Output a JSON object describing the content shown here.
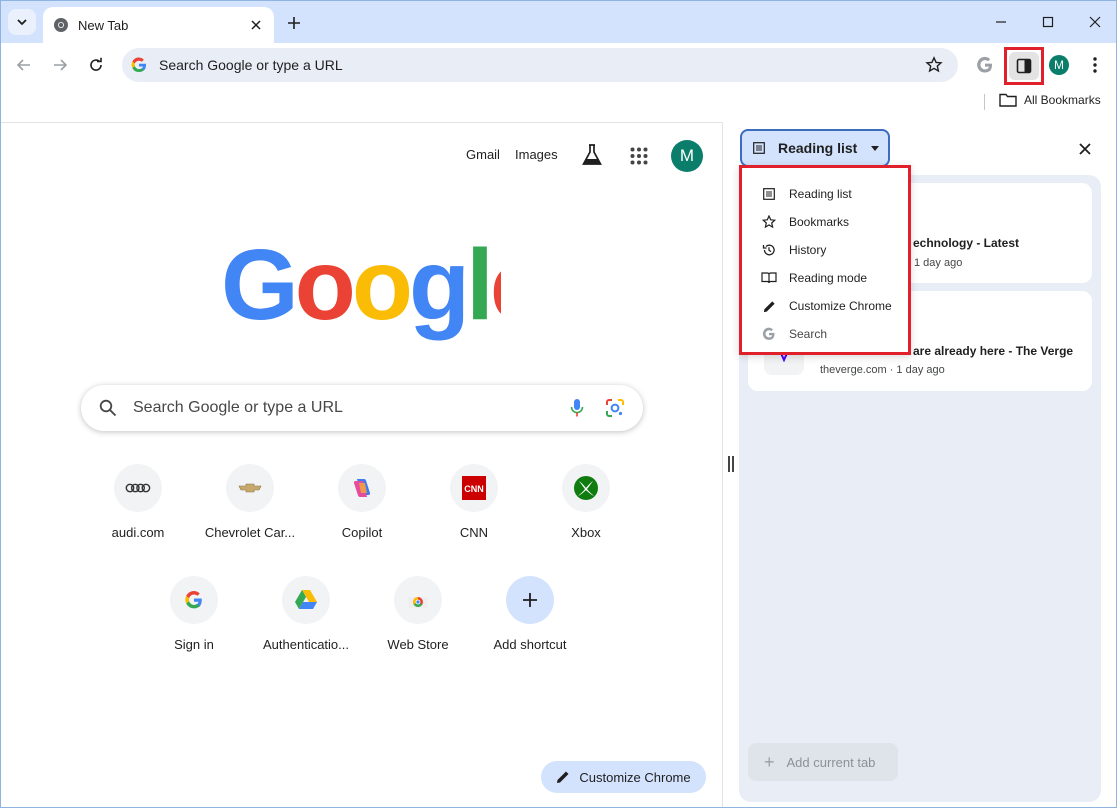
{
  "browser": {
    "tab": {
      "title": "New Tab"
    },
    "toolbar": {
      "omnibox_text": "Search Google or type a URL",
      "avatar_initial": "M"
    },
    "bookmarks_bar": {
      "all_bookmarks": "All Bookmarks"
    }
  },
  "ntp": {
    "links": {
      "gmail": "Gmail",
      "images": "Images"
    },
    "avatar_initial": "M",
    "search_placeholder": "Search Google or type a URL",
    "shortcuts": [
      {
        "label": "audi.com",
        "icon": "audi-logo-icon"
      },
      {
        "label": "Chevrolet Car...",
        "icon": "chevrolet-logo-icon"
      },
      {
        "label": "Copilot",
        "icon": "copilot-logo-icon"
      },
      {
        "label": "CNN",
        "icon": "cnn-logo-icon"
      },
      {
        "label": "Xbox",
        "icon": "xbox-logo-icon"
      },
      {
        "label": "Sign in",
        "icon": "google-g-icon"
      },
      {
        "label": "Authenticatio...",
        "icon": "google-drive-icon"
      },
      {
        "label": "Web Store",
        "icon": "chrome-web-store-icon"
      },
      {
        "label": "Add shortcut",
        "icon": "plus-icon"
      }
    ],
    "customize_button": "Customize Chrome"
  },
  "side_panel": {
    "header_label": "Reading list",
    "dropdown_items": [
      {
        "label": "Reading list",
        "icon": "reading-list-icon"
      },
      {
        "label": "Bookmarks",
        "icon": "bookmarks-star-icon"
      },
      {
        "label": "History",
        "icon": "history-icon"
      },
      {
        "label": "Reading mode",
        "icon": "reading-mode-icon"
      },
      {
        "label": "Customize Chrome",
        "icon": "pencil-icon"
      },
      {
        "label": "Search",
        "icon": "google-g-icon"
      }
    ],
    "reading_list": [
      {
        "title": "echnology - Latest",
        "meta": "1 day ago"
      },
      {
        "title": "are already here - The Verge",
        "meta": "theverge.com · 1 day ago"
      }
    ],
    "add_current_tab": "Add current tab"
  },
  "colors": {
    "titlebar": "#d3e3fd",
    "highlight_red": "#e0212b",
    "avatar": "#0b7d6b",
    "google_blue": "#4285f4",
    "google_red": "#ea4335",
    "google_yellow": "#fbbc05",
    "google_green": "#34a853"
  }
}
